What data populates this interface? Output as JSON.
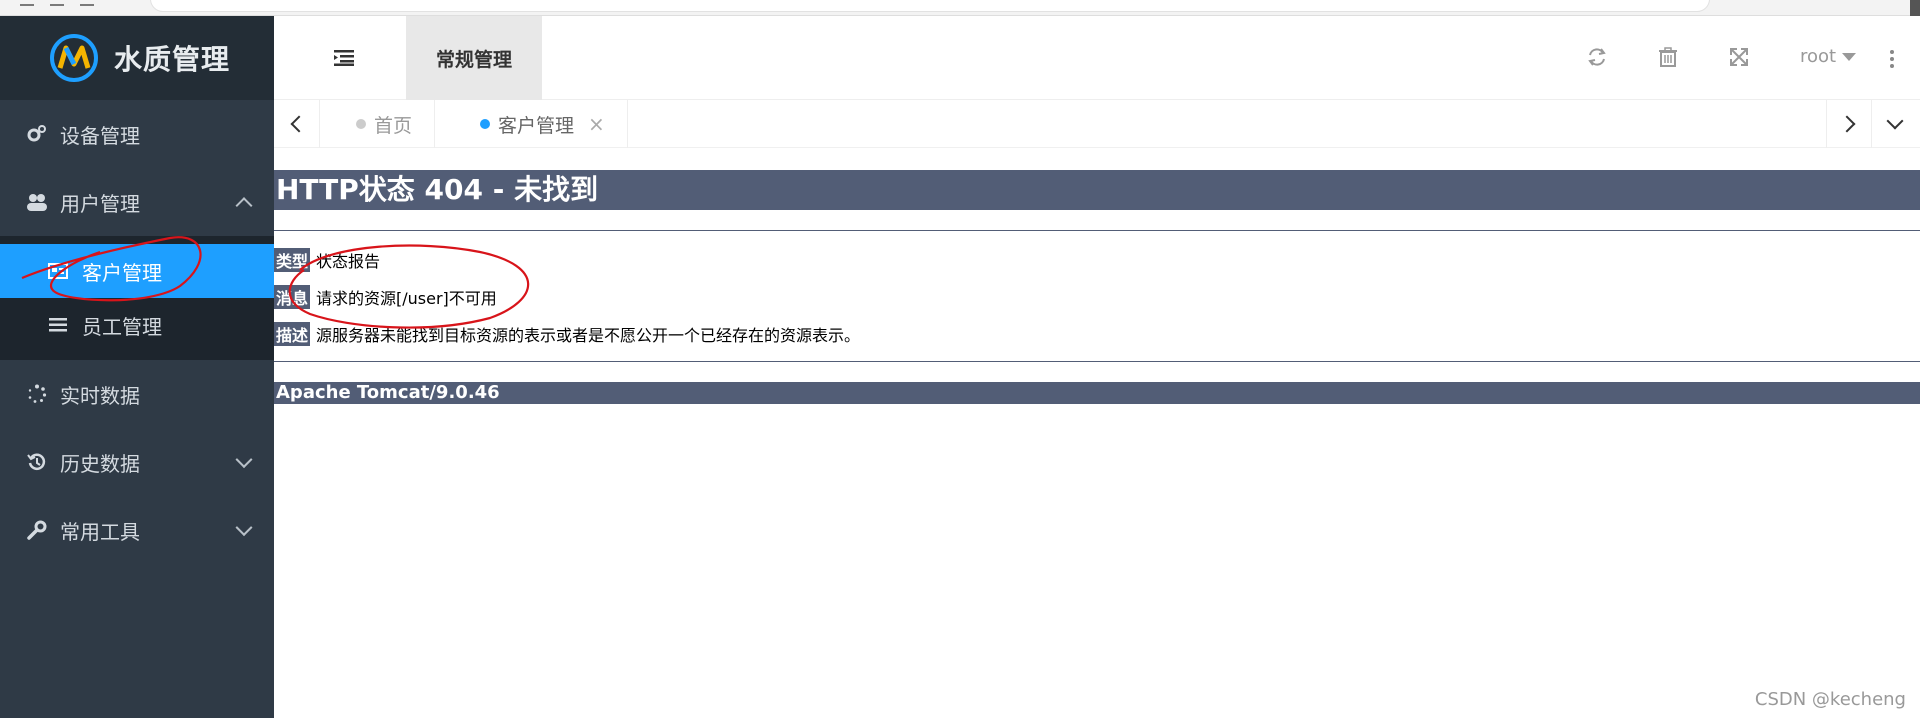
{
  "app": {
    "title": "水质管理"
  },
  "sidebar": {
    "items": [
      {
        "label": "设备管理",
        "icon": "gears-icon"
      },
      {
        "label": "用户管理",
        "icon": "users-icon",
        "expanded": true,
        "children": [
          {
            "label": "客户管理",
            "icon": "contact-card-icon",
            "active": true
          },
          {
            "label": "员工管理",
            "icon": "list-icon",
            "active": false
          }
        ]
      },
      {
        "label": "实时数据",
        "icon": "spinner-icon"
      },
      {
        "label": "历史数据",
        "icon": "history-icon"
      },
      {
        "label": "常用工具",
        "icon": "wrench-icon"
      }
    ]
  },
  "header": {
    "active_module": "常规管理",
    "user": "root"
  },
  "tabs": [
    {
      "label": "首页",
      "active": false
    },
    {
      "label": "客户管理",
      "active": true,
      "close": "×"
    }
  ],
  "error": {
    "title": "HTTP状态 404 - 未找到",
    "type_label": "类型",
    "type_value": "状态报告",
    "message_label": "消息",
    "message_value": "请求的资源[/user]不可用",
    "desc_label": "描述",
    "desc_value": "源服务器未能找到目标资源的表示或者是不愿公开一个已经存在的资源表示。",
    "server": "Apache Tomcat/9.0.46"
  },
  "watermark": "CSDN @kecheng",
  "colors": {
    "sidebar_bg": "#2f3a46",
    "active_blue": "#1e9fff",
    "tomcat_bar": "#525d76",
    "annotation_red": "#d8141a"
  }
}
